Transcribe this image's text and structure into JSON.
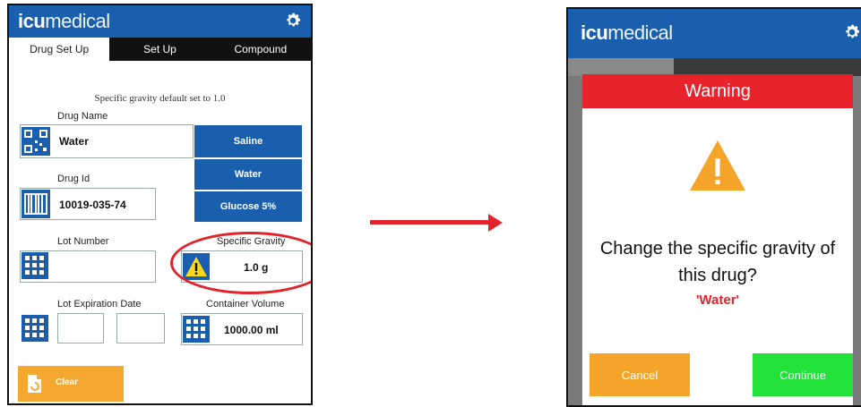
{
  "left_screen": {
    "brand_bold": "icu",
    "brand_light": "medical",
    "tabs": [
      {
        "label": "Drug Set Up"
      },
      {
        "label": "Set Up"
      },
      {
        "label": "Compound"
      }
    ],
    "note": "Specific gravity default set to 1.0",
    "drug_name_label": "Drug Name",
    "drug_name_value": "Water",
    "drug_id_label": "Drug Id",
    "drug_id_value": "10019-035-74",
    "quick_buttons": [
      {
        "label": "Saline"
      },
      {
        "label": "Water"
      },
      {
        "label": "Glucose 5%"
      }
    ],
    "lot_number_label": "Lot Number",
    "specific_gravity_label": "Specific Gravity",
    "specific_gravity_value": "1.0 g",
    "lot_expiration_label": "Lot Expiration Date",
    "container_volume_label": "Container Volume",
    "container_volume_value": "1000.00 ml",
    "clear_label": "Clear",
    "highlight_color": "#e0242b",
    "brand_color": "#1a5fad"
  },
  "right_screen": {
    "brand_bold": "icu",
    "brand_light": "medical",
    "dialog": {
      "title": "Warning",
      "message_line1": "Change the specific gravity of",
      "message_line2": "this drug?",
      "drug": "'Water'",
      "cancel_label": "Cancel",
      "continue_label": "Continue"
    },
    "warning_color": "#e8232b",
    "cancel_color": "#f5a42a",
    "continue_color": "#22e23a"
  },
  "icons": [
    "gear-icon",
    "qr-code-icon",
    "barcode-icon",
    "keypad-icon",
    "warning-icon",
    "clear-icon",
    "arrow-right-icon"
  ]
}
